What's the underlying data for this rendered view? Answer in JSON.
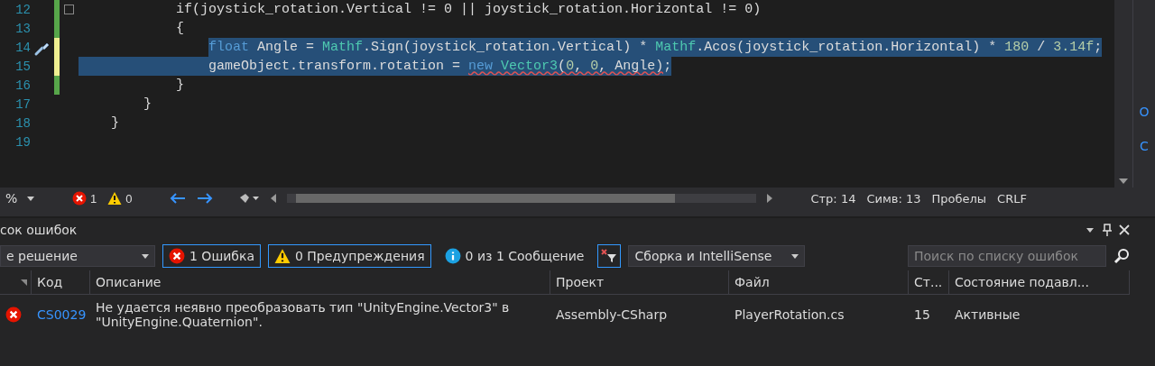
{
  "editor": {
    "lines": [
      {
        "number": "12",
        "color": "#57a64a",
        "fold": true,
        "quick_action": false,
        "tokens": [
          {
            "kind": "plain",
            "text": "            if(joystick_rotation.Vertical != 0 || joystick_rotation.Horizontal != 0)",
            "squiggle": false
          }
        ]
      },
      {
        "number": "13",
        "color": "#57a64a",
        "fold": false,
        "quick_action": false,
        "tokens": [
          {
            "kind": "plain",
            "text": "            {",
            "squiggle": false
          }
        ]
      },
      {
        "number": "14",
        "color": "#efef91",
        "fold": false,
        "quick_action": true,
        "selected": true,
        "indent_selected": false,
        "tokens": [
          {
            "kind": "keyword",
            "text": "                float",
            "squiggle": false
          },
          {
            "kind": "plain",
            "text": " Angle = ",
            "squiggle": false
          },
          {
            "kind": "type",
            "text": "Mathf",
            "squiggle": false
          },
          {
            "kind": "plain",
            "text": ".Sign(joystick_rotation.Vertical) * ",
            "squiggle": false
          },
          {
            "kind": "type",
            "text": "Mathf",
            "squiggle": false
          },
          {
            "kind": "plain",
            "text": ".Acos(joystick_rotation.Horizontal) * ",
            "squiggle": false
          },
          {
            "kind": "number",
            "text": "180",
            "squiggle": false
          },
          {
            "kind": "plain",
            "text": " / ",
            "squiggle": false
          },
          {
            "kind": "number",
            "text": "3.14f",
            "squiggle": false
          },
          {
            "kind": "plain",
            "text": ";",
            "squiggle": false
          }
        ]
      },
      {
        "number": "15",
        "color": "#efef91",
        "fold": false,
        "quick_action": false,
        "selected": true,
        "indent_selected": true,
        "tokens": [
          {
            "kind": "plain",
            "text": "                gameObject.transform.rotation = ",
            "squiggle": false
          },
          {
            "kind": "keyword",
            "text": "new",
            "squiggle": true
          },
          {
            "kind": "type",
            "text": " Vector3",
            "squiggle": true
          },
          {
            "kind": "plain",
            "text": "(",
            "squiggle": true
          },
          {
            "kind": "number",
            "text": "0",
            "squiggle": true
          },
          {
            "kind": "plain",
            "text": ", ",
            "squiggle": true
          },
          {
            "kind": "number",
            "text": "0",
            "squiggle": true
          },
          {
            "kind": "plain",
            "text": ", Angle)",
            "squiggle": true
          },
          {
            "kind": "plain",
            "text": ";",
            "squiggle": false
          }
        ]
      },
      {
        "number": "16",
        "color": "#57a64a",
        "fold": false,
        "quick_action": false,
        "tokens": [
          {
            "kind": "plain",
            "text": "            }",
            "squiggle": false
          }
        ]
      },
      {
        "number": "17",
        "fold": false,
        "quick_action": false,
        "tokens": [
          {
            "kind": "plain",
            "text": "        }",
            "squiggle": false
          }
        ]
      },
      {
        "number": "18",
        "fold": false,
        "quick_action": false,
        "tokens": [
          {
            "kind": "plain",
            "text": "    }",
            "squiggle": false
          }
        ]
      },
      {
        "number": "19",
        "fold": false,
        "quick_action": false
      }
    ]
  },
  "right_strip": [
    "О",
    "С"
  ],
  "status_bar": {
    "zoom": "%",
    "errors": "1",
    "warnings": "0",
    "line": "Стр: 14",
    "column": "Симв: 13",
    "indent": "Пробелы",
    "line_ending": "CRLF"
  },
  "error_list": {
    "title": "сок ошибок",
    "scope": "е решение",
    "filters": [
      {
        "kind": "error",
        "label": "1 Ошибка",
        "selected": true
      },
      {
        "kind": "warning",
        "label": "0 Предупреждения",
        "selected": true
      },
      {
        "kind": "info",
        "label": "0 из 1 Сообщение",
        "selected": false
      }
    ],
    "source": "Сборка и IntelliSense",
    "search": {
      "placeholder": "Поиск по списку ошибок"
    },
    "columns": [
      "Код",
      "Описание",
      "Проект",
      "Файл",
      "Ст...",
      "Состояние подавл..."
    ],
    "rows": [
      {
        "kind": "error",
        "code": "CS0029",
        "description": "Не удается неявно преобразовать тип \"UnityEngine.Vector3\" в \"UnityEngine.Quaternion\".",
        "project": "Assembly-CSharp",
        "file": "PlayerRotation.cs",
        "line": "15",
        "state": "Активные"
      }
    ]
  }
}
